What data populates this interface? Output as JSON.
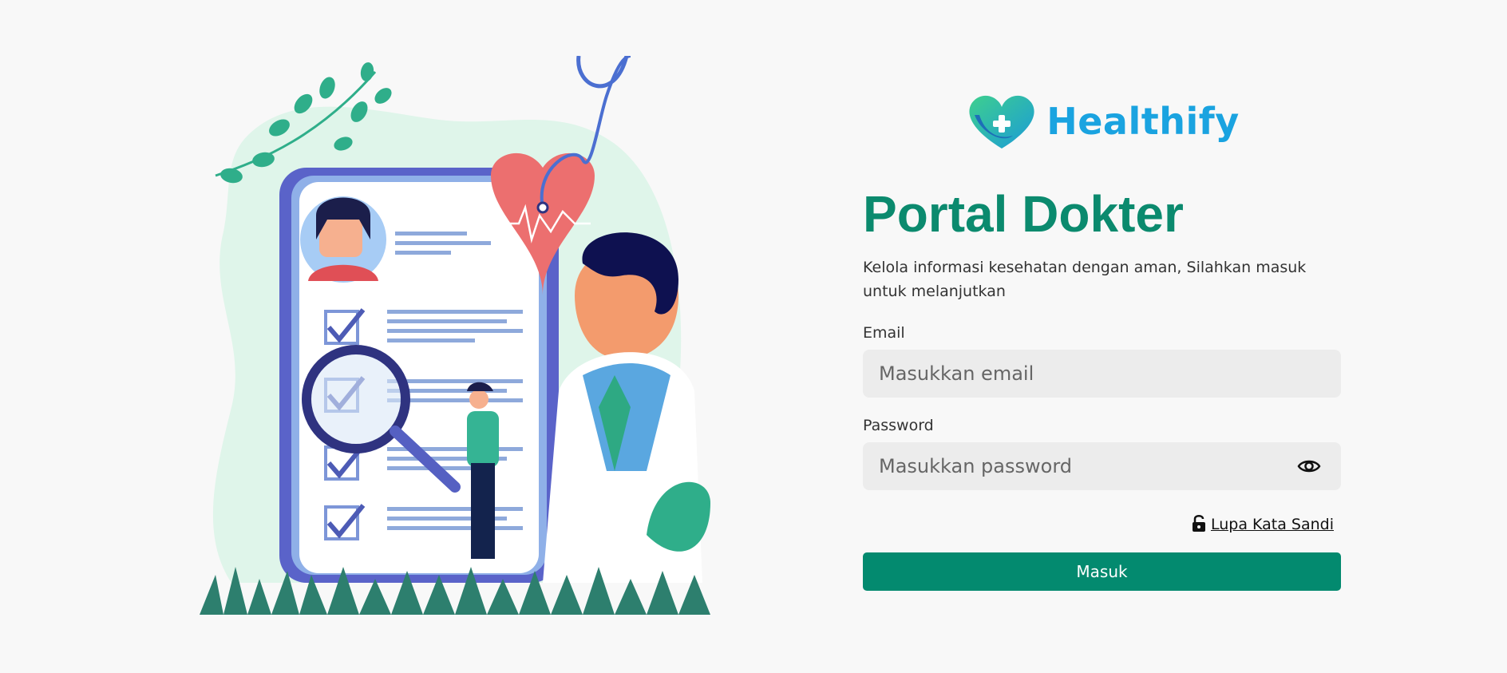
{
  "brand": {
    "name": "Healthify"
  },
  "header": {
    "title": "Portal Dokter",
    "subtitle": "Kelola informasi kesehatan dengan aman, Silahkan masuk untuk melanjutkan"
  },
  "form": {
    "email_label": "Email",
    "email_placeholder": "Masukkan email",
    "password_label": "Password",
    "password_placeholder": "Masukkan password",
    "forgot_label": "Lupa Kata Sandi",
    "submit_label": "Masuk"
  },
  "colors": {
    "primary": "#038a6f",
    "title": "#0b8a6e",
    "brand_blue": "#1aa3e0",
    "input_bg": "#ececec",
    "page_bg": "#f8f8f8"
  },
  "icons": {
    "password_toggle": "eye-icon",
    "forgot": "unlock-icon",
    "logo": "heart-logo-icon"
  }
}
